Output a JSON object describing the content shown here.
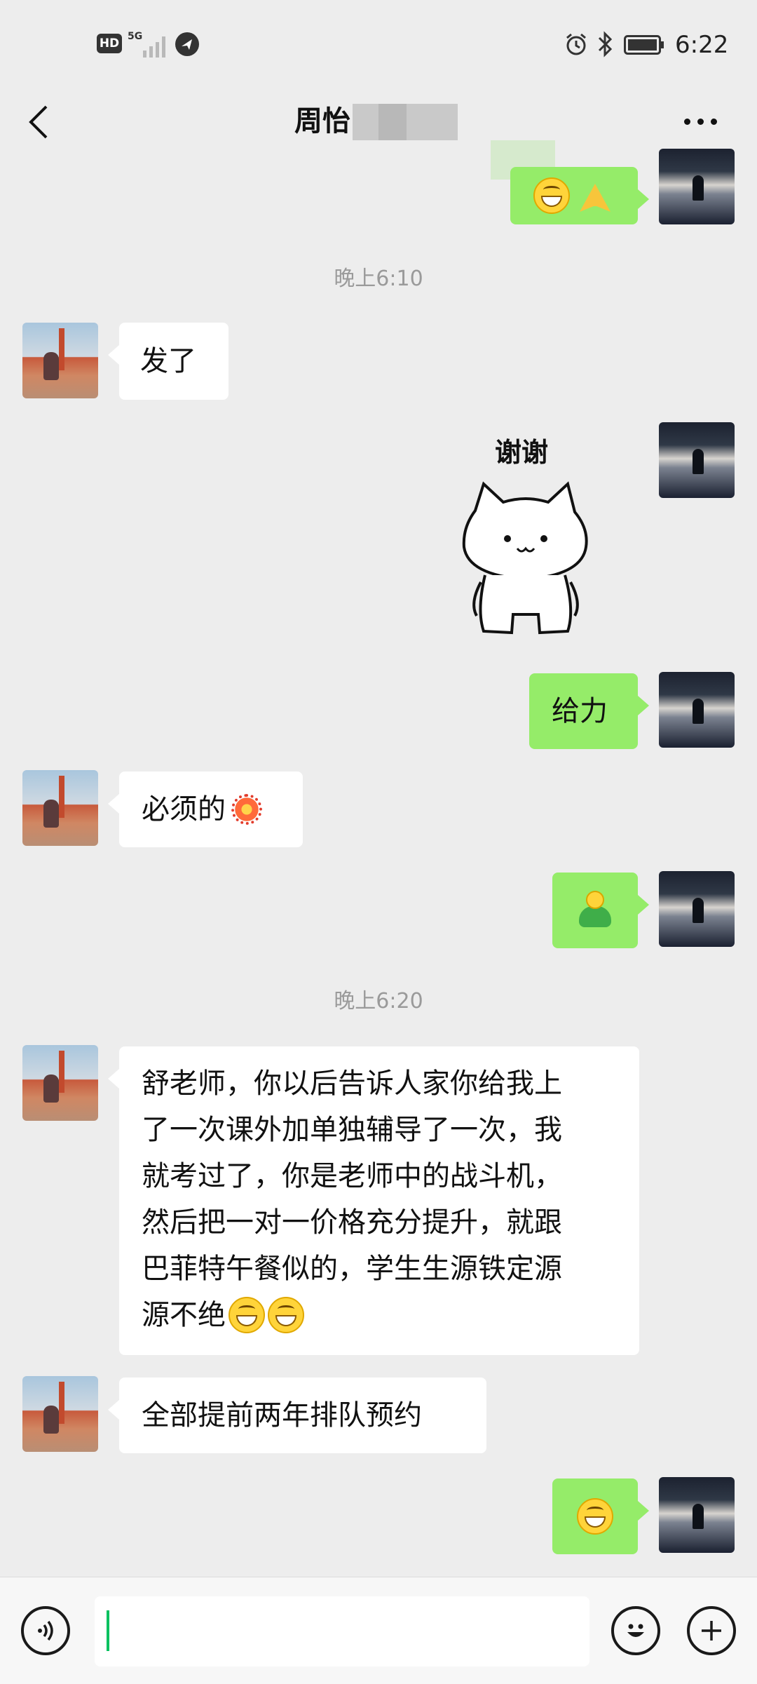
{
  "status_bar": {
    "hd": "HD",
    "network": "5G",
    "time": "6:22"
  },
  "header": {
    "title": "周怡"
  },
  "timestamps": [
    "晚上6:10",
    "晚上6:20"
  ],
  "messages": {
    "m2": "发了",
    "m3_sticker_caption": "谢谢",
    "m4": "给力",
    "m5": "必须的",
    "m7_lines": [
      "舒老师，你以后告诉人家你给我上",
      "了一次课外加单独辅导了一次，我",
      "就考过了，你是老师中的战斗机，",
      "然后把一对一价格充分提升，就跟",
      "巴菲特午餐似的，学生生源铁定源",
      "源不绝"
    ],
    "m8": "全部提前两年排队预约"
  },
  "icons": {
    "back": "back-arrow-icon",
    "more": "more-dots-icon",
    "voice": "voice-icon",
    "emoji": "emoji-icon",
    "plus": "plus-icon"
  },
  "colors": {
    "outgoing_bubble": "#95ec69",
    "incoming_bubble": "#ffffff",
    "background": "#ededed",
    "caret": "#07c160"
  }
}
